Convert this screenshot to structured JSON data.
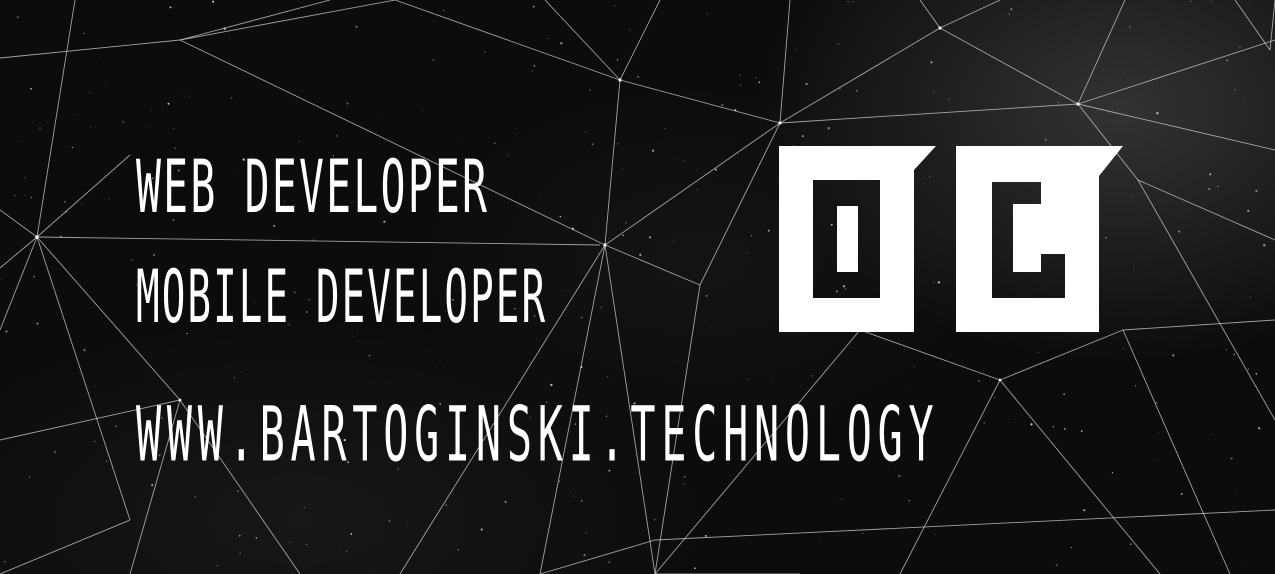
{
  "banner": {
    "line1": "WEB DEVELOPER",
    "line2": "MOBILE DEVELOPER",
    "website": "WWW.BARTOGINSKI.TECHNOLOGY",
    "logo_icon": "bg-monogram-logo",
    "background": "starfield-with-network-lines"
  },
  "colors": {
    "background": "#0c0c0e",
    "text": "#ffffff",
    "lines": "#cfd3d8"
  }
}
